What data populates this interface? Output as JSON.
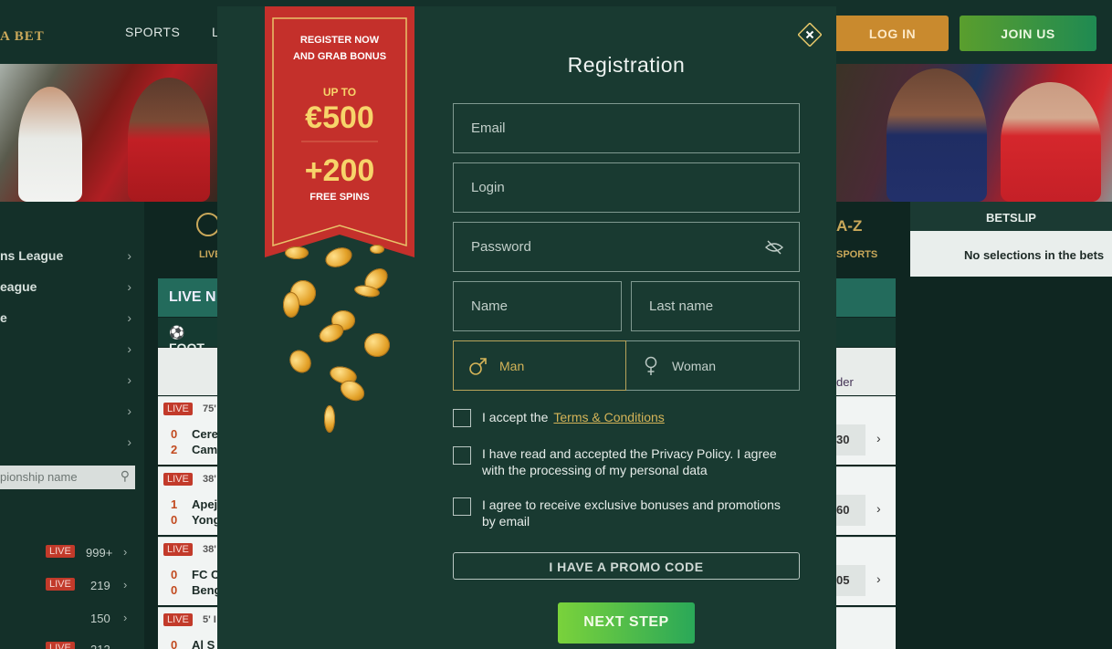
{
  "site": {
    "logo": "A BET",
    "nav_sports": "SPORTS",
    "nav_l": "L",
    "login": "LOG IN",
    "join": "JOIN US"
  },
  "sidebar": {
    "items": [
      "ns League",
      "eague",
      "e",
      "",
      "",
      "",
      ""
    ],
    "search_placeholder": "pionship name",
    "counts": [
      {
        "live": "LIVE",
        "count": "999+"
      },
      {
        "live": "LIVE",
        "count": "219"
      },
      {
        "live": "",
        "count": "150"
      },
      {
        "live": "LIVE",
        "count": "212"
      }
    ]
  },
  "center": {
    "live_label": "LIVE",
    "sports_az": "A-Z",
    "sports_label": "SPORTS",
    "live_now": "LIVE N",
    "football": "FOOT",
    "order": "der",
    "matches": [
      {
        "badge": "LIVE",
        "time": "75'",
        "s1": "0",
        "s2": "2",
        "t1": "Cere",
        "t2": "Cam",
        "odd": "30"
      },
      {
        "badge": "LIVE",
        "time": "38'",
        "s1": "1",
        "s2": "0",
        "t1": "Apej",
        "t2": "Yong",
        "odd": "60"
      },
      {
        "badge": "LIVE",
        "time": "38'",
        "s1": "0",
        "s2": "0",
        "t1": "FC C",
        "t2": "Beng",
        "odd": "05"
      },
      {
        "badge": "LIVE",
        "time": "5' I",
        "s1": "0",
        "s2": "",
        "t1": "Al S",
        "t2": "",
        "odd": ""
      }
    ]
  },
  "betslip": {
    "title": "BETSLIP",
    "empty": "No selections in the bets"
  },
  "ribbon": {
    "line1": "REGISTER NOW",
    "line2": "AND GRAB BONUS",
    "up_to": "UP TO",
    "amount": "€500",
    "spins_amount": "+200",
    "spins_label": "FREE SPINS"
  },
  "modal": {
    "title": "Registration",
    "email_placeholder": "Email",
    "login_placeholder": "Login",
    "password_placeholder": "Password",
    "name_placeholder": "Name",
    "lastname_placeholder": "Last name",
    "gender_man": "Man",
    "gender_woman": "Woman",
    "accept_prefix": "I accept the",
    "terms_link": "Terms & Conditions",
    "privacy_text": "I have read and accepted the Privacy Policy. I agree with the processing of my personal data",
    "bonus_text": "I agree to receive exclusive bonuses and promotions by email",
    "promo_button": "I HAVE A PROMO CODE",
    "next_button": "NEXT STEP"
  },
  "colors": {
    "modal_bg": "#193a31",
    "accent_gold": "#d4b458",
    "ribbon_red": "#c4302b",
    "next_green": "#56bd4a",
    "login_orange": "#c98a2e"
  },
  "icons": {
    "close": "close-icon",
    "eye": "eye-hidden-icon",
    "man": "male-icon",
    "woman": "female-icon",
    "search": "search-icon",
    "chevron": "chevron-right-icon"
  }
}
